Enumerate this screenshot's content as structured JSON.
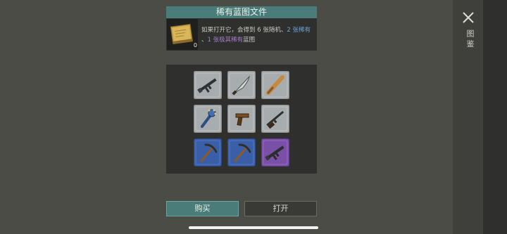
{
  "dialog": {
    "title": "稀有蓝图文件",
    "item_count": "0",
    "description": {
      "part1": "如果打开它，会得到 6 张随机、",
      "part2_blue": "2 张稀有",
      "part3": "、",
      "part4_purple": "1 张极其稀有",
      "part5": "蓝图"
    }
  },
  "side": {
    "label": "图 鉴"
  },
  "grid": {
    "items": [
      {
        "rarity": "common",
        "icon": "assault-rifle-icon"
      },
      {
        "rarity": "common",
        "icon": "machete-icon"
      },
      {
        "rarity": "common",
        "icon": "baseball-bat-icon"
      },
      {
        "rarity": "common",
        "icon": "spiked-mace-icon"
      },
      {
        "rarity": "common",
        "icon": "pistol-icon"
      },
      {
        "rarity": "common",
        "icon": "shotgun-icon"
      },
      {
        "rarity": "rare",
        "icon": "pickaxe-icon"
      },
      {
        "rarity": "rare",
        "icon": "pickaxe-icon"
      },
      {
        "rarity": "epic",
        "icon": "assault-rifle-icon"
      }
    ]
  },
  "buttons": {
    "buy": "购买",
    "open": "打开"
  },
  "colors": {
    "accent": "#4a7d79",
    "common_card": "#a7acae",
    "rare_card": "#3a5fa8",
    "epic_card": "#7a4fa8",
    "rare_text": "#6aa3d8",
    "epic_text": "#a67ad1"
  }
}
